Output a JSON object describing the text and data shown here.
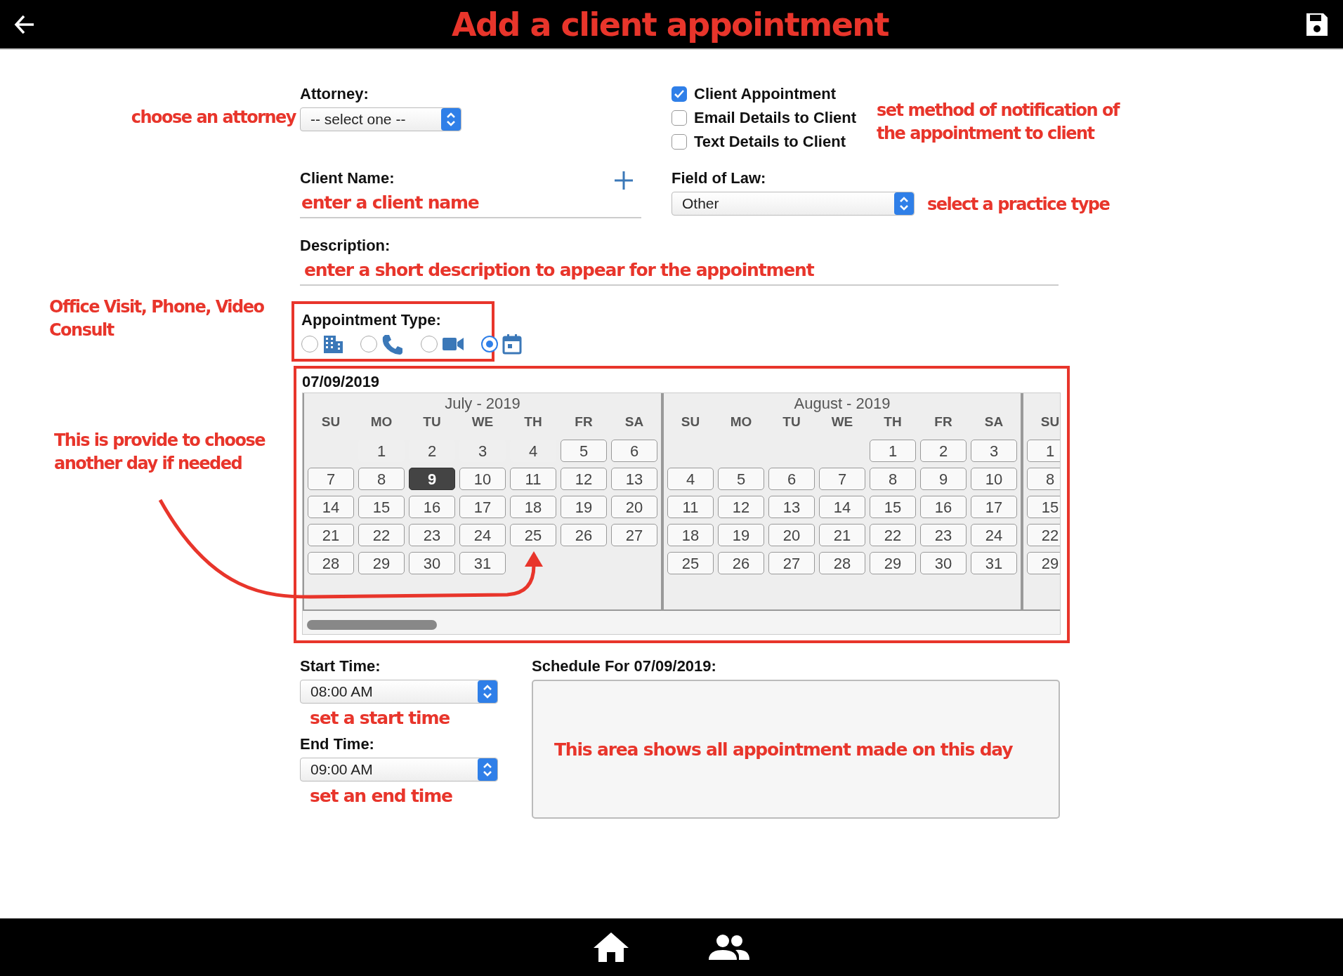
{
  "header": {
    "title": "Add a client appointment"
  },
  "attorney": {
    "label": "Attorney:",
    "value": "-- select one --",
    "annotation": "choose an attorney"
  },
  "notifications": {
    "options": [
      {
        "label": "Client Appointment",
        "checked": true
      },
      {
        "label": "Email Details to Client",
        "checked": false
      },
      {
        "label": "Text Details to Client",
        "checked": false
      }
    ],
    "annotation": "set method of notification of the appointment to client"
  },
  "client_name": {
    "label": "Client Name:",
    "annotation": "enter a client name"
  },
  "field_of_law": {
    "label": "Field of Law:",
    "value": "Other",
    "annotation": "select a practice type"
  },
  "description": {
    "label": "Description:",
    "annotation": "enter a short description to appear for the appointment"
  },
  "appointment_type": {
    "label": "Appointment Type:",
    "annotation": "Office Visit, Phone, Video Consult",
    "options": [
      {
        "kind": "office",
        "selected": false
      },
      {
        "kind": "phone",
        "selected": false
      },
      {
        "kind": "video",
        "selected": false
      },
      {
        "kind": "calendar",
        "selected": true
      }
    ]
  },
  "calendar": {
    "date": "07/09/2019",
    "annotation": "This is provide to choose another day if needed",
    "months": [
      {
        "title": "July - 2019",
        "weekdays": [
          "SU",
          "MO",
          "TU",
          "WE",
          "TH",
          "FR",
          "SA"
        ],
        "weeks": [
          [
            {
              "label": "1",
              "disabled": true,
              "selected": false
            },
            {
              "label": "2",
              "disabled": true,
              "selected": false
            },
            {
              "label": "3",
              "disabled": true,
              "selected": false
            },
            {
              "label": "4",
              "disabled": true,
              "selected": false
            },
            {
              "label": "5",
              "disabled": false,
              "selected": false
            },
            {
              "label": "6",
              "disabled": false,
              "selected": false
            }
          ],
          [
            {
              "label": "7",
              "disabled": false,
              "selected": false
            },
            {
              "label": "8",
              "disabled": false,
              "selected": false
            },
            {
              "label": "9",
              "disabled": false,
              "selected": true
            },
            {
              "label": "10",
              "disabled": false,
              "selected": false
            },
            {
              "label": "11",
              "disabled": false,
              "selected": false
            },
            {
              "label": "12",
              "disabled": false,
              "selected": false
            },
            {
              "label": "13",
              "disabled": false,
              "selected": false
            }
          ],
          [
            {
              "label": "14",
              "disabled": false,
              "selected": false
            },
            {
              "label": "15",
              "disabled": false,
              "selected": false
            },
            {
              "label": "16",
              "disabled": false,
              "selected": false
            },
            {
              "label": "17",
              "disabled": false,
              "selected": false
            },
            {
              "label": "18",
              "disabled": false,
              "selected": false
            },
            {
              "label": "19",
              "disabled": false,
              "selected": false
            },
            {
              "label": "20",
              "disabled": false,
              "selected": false
            }
          ],
          [
            {
              "label": "21",
              "disabled": false,
              "selected": false
            },
            {
              "label": "22",
              "disabled": false,
              "selected": false
            },
            {
              "label": "23",
              "disabled": false,
              "selected": false
            },
            {
              "label": "24",
              "disabled": false,
              "selected": false
            },
            {
              "label": "25",
              "disabled": false,
              "selected": false
            },
            {
              "label": "26",
              "disabled": false,
              "selected": false
            },
            {
              "label": "27",
              "disabled": false,
              "selected": false
            }
          ],
          [
            {
              "label": "28",
              "disabled": false,
              "selected": false
            },
            {
              "label": "29",
              "disabled": false,
              "selected": false
            },
            {
              "label": "30",
              "disabled": false,
              "selected": false
            },
            {
              "label": "31",
              "disabled": false,
              "selected": false
            }
          ]
        ]
      },
      {
        "title": "August - 2019",
        "weekdays": [
          "SU",
          "MO",
          "TU",
          "WE",
          "TH",
          "FR",
          "SA"
        ],
        "weeks": [
          [
            {
              "label": "1",
              "disabled": false,
              "selected": false
            },
            {
              "label": "2",
              "disabled": false,
              "selected": false
            },
            {
              "label": "3",
              "disabled": false,
              "selected": false
            }
          ],
          [
            {
              "label": "4",
              "disabled": false,
              "selected": false
            },
            {
              "label": "5",
              "disabled": false,
              "selected": false
            },
            {
              "label": "6",
              "disabled": false,
              "selected": false
            },
            {
              "label": "7",
              "disabled": false,
              "selected": false
            },
            {
              "label": "8",
              "disabled": false,
              "selected": false
            },
            {
              "label": "9",
              "disabled": false,
              "selected": false
            },
            {
              "label": "10",
              "disabled": false,
              "selected": false
            }
          ],
          [
            {
              "label": "11",
              "disabled": false,
              "selected": false
            },
            {
              "label": "12",
              "disabled": false,
              "selected": false
            },
            {
              "label": "13",
              "disabled": false,
              "selected": false
            },
            {
              "label": "14",
              "disabled": false,
              "selected": false
            },
            {
              "label": "15",
              "disabled": false,
              "selected": false
            },
            {
              "label": "16",
              "disabled": false,
              "selected": false
            },
            {
              "label": "17",
              "disabled": false,
              "selected": false
            }
          ],
          [
            {
              "label": "18",
              "disabled": false,
              "selected": false
            },
            {
              "label": "19",
              "disabled": false,
              "selected": false
            },
            {
              "label": "20",
              "disabled": false,
              "selected": false
            },
            {
              "label": "21",
              "disabled": false,
              "selected": false
            },
            {
              "label": "22",
              "disabled": false,
              "selected": false
            },
            {
              "label": "23",
              "disabled": false,
              "selected": false
            },
            {
              "label": "24",
              "disabled": false,
              "selected": false
            }
          ],
          [
            {
              "label": "25",
              "disabled": false,
              "selected": false
            },
            {
              "label": "26",
              "disabled": false,
              "selected": false
            },
            {
              "label": "27",
              "disabled": false,
              "selected": false
            },
            {
              "label": "28",
              "disabled": false,
              "selected": false
            },
            {
              "label": "29",
              "disabled": false,
              "selected": false
            },
            {
              "label": "30",
              "disabled": false,
              "selected": false
            },
            {
              "label": "31",
              "disabled": false,
              "selected": false
            }
          ]
        ]
      },
      {
        "weekdays": [
          "SU"
        ],
        "weeks": [
          [
            {
              "label": "1",
              "disabled": false,
              "selected": false
            }
          ],
          [
            {
              "label": "8",
              "disabled": false,
              "selected": false
            }
          ],
          [
            {
              "label": "15",
              "disabled": false,
              "selected": false
            }
          ],
          [
            {
              "label": "22",
              "disabled": false,
              "selected": false
            }
          ],
          [
            {
              "label": "29",
              "disabled": false,
              "selected": false
            }
          ]
        ]
      }
    ]
  },
  "start_time": {
    "label": "Start Time:",
    "value": "08:00 AM",
    "annotation": "set a start time"
  },
  "end_time": {
    "label": "End Time:",
    "value": "09:00 AM",
    "annotation": "set an end time"
  },
  "schedule": {
    "label": "Schedule For 07/09/2019:",
    "annotation": "This area shows all appointment made on this day"
  }
}
